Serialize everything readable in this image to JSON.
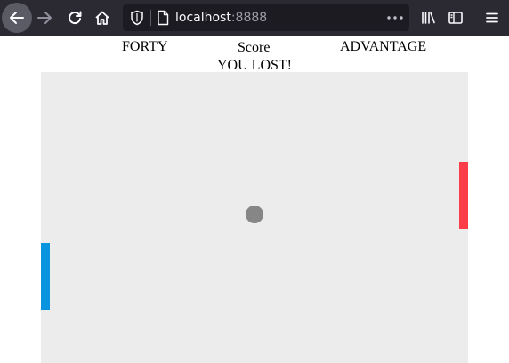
{
  "browser": {
    "url_host": "localhost",
    "url_port": ":8888",
    "icons": [
      "back-arrow-icon",
      "forward-arrow-icon",
      "reload-icon",
      "home-icon",
      "shield-icon",
      "page-icon",
      "more-icon",
      "library-icon",
      "sidebar-icon",
      "menu-icon"
    ]
  },
  "scoreboard": {
    "left_score": "FORTY",
    "title": "Score",
    "right_score": "ADVANTAGE",
    "status": "YOU LOST!"
  },
  "game": {
    "colors": {
      "field": "#ececec",
      "left_paddle": "#0994df",
      "right_paddle": "#fa3d46",
      "ball": "#868686"
    }
  }
}
